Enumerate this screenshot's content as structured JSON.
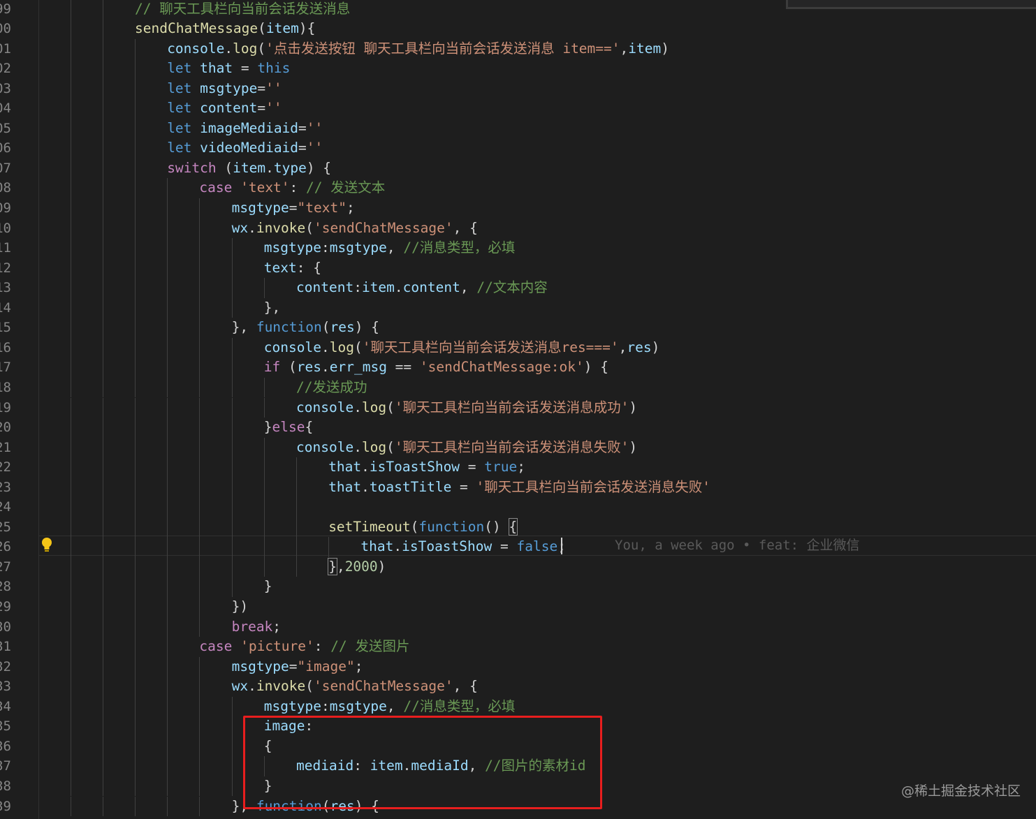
{
  "editor": {
    "lines": [
      {
        "ln": "99",
        "indent": 0,
        "tokens": [
          {
            "t": "com",
            "v": "// 聊天工具栏向当前会话发送消息"
          }
        ]
      },
      {
        "ln": "00",
        "indent": 0,
        "tokens": [
          {
            "t": "fn",
            "v": "sendChatMessage"
          },
          {
            "t": "pun",
            "v": "("
          },
          {
            "t": "var",
            "v": "item"
          },
          {
            "t": "pun",
            "v": "){"
          }
        ]
      },
      {
        "ln": "01",
        "indent": 1,
        "tokens": [
          {
            "t": "var",
            "v": "console"
          },
          {
            "t": "pun",
            "v": "."
          },
          {
            "t": "fn",
            "v": "log"
          },
          {
            "t": "pun",
            "v": "("
          },
          {
            "t": "str",
            "v": "'点击发送按钮 聊天工具栏向当前会话发送消息 item=='"
          },
          {
            "t": "pun",
            "v": ","
          },
          {
            "t": "var",
            "v": "item"
          },
          {
            "t": "pun",
            "v": ")"
          }
        ]
      },
      {
        "ln": "02",
        "indent": 1,
        "tokens": [
          {
            "t": "kw",
            "v": "let "
          },
          {
            "t": "var",
            "v": "that"
          },
          {
            "t": "pun",
            "v": " = "
          },
          {
            "t": "kw",
            "v": "this"
          }
        ]
      },
      {
        "ln": "03",
        "indent": 1,
        "tokens": [
          {
            "t": "kw",
            "v": "let "
          },
          {
            "t": "var",
            "v": "msgtype"
          },
          {
            "t": "pun",
            "v": "="
          },
          {
            "t": "str",
            "v": "''"
          }
        ]
      },
      {
        "ln": "04",
        "indent": 1,
        "tokens": [
          {
            "t": "kw",
            "v": "let "
          },
          {
            "t": "var",
            "v": "content"
          },
          {
            "t": "pun",
            "v": "="
          },
          {
            "t": "str",
            "v": "''"
          }
        ]
      },
      {
        "ln": "05",
        "indent": 1,
        "tokens": [
          {
            "t": "kw",
            "v": "let "
          },
          {
            "t": "var",
            "v": "imageMediaid"
          },
          {
            "t": "pun",
            "v": "="
          },
          {
            "t": "str",
            "v": "''"
          }
        ]
      },
      {
        "ln": "06",
        "indent": 1,
        "tokens": [
          {
            "t": "kw",
            "v": "let "
          },
          {
            "t": "var",
            "v": "videoMediaid"
          },
          {
            "t": "pun",
            "v": "="
          },
          {
            "t": "str",
            "v": "''"
          }
        ]
      },
      {
        "ln": "07",
        "indent": 1,
        "tokens": [
          {
            "t": "ctl",
            "v": "switch"
          },
          {
            "t": "pun",
            "v": " ("
          },
          {
            "t": "var",
            "v": "item"
          },
          {
            "t": "pun",
            "v": "."
          },
          {
            "t": "var",
            "v": "type"
          },
          {
            "t": "pun",
            "v": ") {"
          }
        ]
      },
      {
        "ln": "08",
        "indent": 2,
        "tokens": [
          {
            "t": "ctl",
            "v": "case "
          },
          {
            "t": "str",
            "v": "'text'"
          },
          {
            "t": "pun",
            "v": ": "
          },
          {
            "t": "com",
            "v": "// 发送文本"
          }
        ]
      },
      {
        "ln": "09",
        "indent": 3,
        "tokens": [
          {
            "t": "var",
            "v": "msgtype"
          },
          {
            "t": "pun",
            "v": "="
          },
          {
            "t": "str",
            "v": "\"text\""
          },
          {
            "t": "pun",
            "v": ";"
          }
        ]
      },
      {
        "ln": "10",
        "indent": 3,
        "tokens": [
          {
            "t": "var",
            "v": "wx"
          },
          {
            "t": "pun",
            "v": "."
          },
          {
            "t": "fn",
            "v": "invoke"
          },
          {
            "t": "pun",
            "v": "("
          },
          {
            "t": "str",
            "v": "'sendChatMessage'"
          },
          {
            "t": "pun",
            "v": ", {"
          }
        ]
      },
      {
        "ln": "11",
        "indent": 4,
        "tokens": [
          {
            "t": "var",
            "v": "msgtype"
          },
          {
            "t": "pun",
            "v": ":"
          },
          {
            "t": "var",
            "v": "msgtype"
          },
          {
            "t": "pun",
            "v": ", "
          },
          {
            "t": "com",
            "v": "//消息类型，必填"
          }
        ]
      },
      {
        "ln": "12",
        "indent": 4,
        "tokens": [
          {
            "t": "var",
            "v": "text"
          },
          {
            "t": "pun",
            "v": ": {"
          }
        ]
      },
      {
        "ln": "13",
        "indent": 5,
        "tokens": [
          {
            "t": "var",
            "v": "content"
          },
          {
            "t": "pun",
            "v": ":"
          },
          {
            "t": "var",
            "v": "item"
          },
          {
            "t": "pun",
            "v": "."
          },
          {
            "t": "var",
            "v": "content"
          },
          {
            "t": "pun",
            "v": ", "
          },
          {
            "t": "com",
            "v": "//文本内容"
          }
        ]
      },
      {
        "ln": "14",
        "indent": 4,
        "tokens": [
          {
            "t": "pun",
            "v": "},"
          }
        ]
      },
      {
        "ln": "15",
        "indent": 3,
        "tokens": [
          {
            "t": "pun",
            "v": "}, "
          },
          {
            "t": "kw",
            "v": "function"
          },
          {
            "t": "pun",
            "v": "("
          },
          {
            "t": "var",
            "v": "res"
          },
          {
            "t": "pun",
            "v": ") {"
          }
        ]
      },
      {
        "ln": "16",
        "indent": 4,
        "tokens": [
          {
            "t": "var",
            "v": "console"
          },
          {
            "t": "pun",
            "v": "."
          },
          {
            "t": "fn",
            "v": "log"
          },
          {
            "t": "pun",
            "v": "("
          },
          {
            "t": "str",
            "v": "'聊天工具栏向当前会话发送消息res==='"
          },
          {
            "t": "pun",
            "v": ","
          },
          {
            "t": "var",
            "v": "res"
          },
          {
            "t": "pun",
            "v": ")"
          }
        ]
      },
      {
        "ln": "17",
        "indent": 4,
        "tokens": [
          {
            "t": "ctl",
            "v": "if"
          },
          {
            "t": "pun",
            "v": " ("
          },
          {
            "t": "var",
            "v": "res"
          },
          {
            "t": "pun",
            "v": "."
          },
          {
            "t": "var",
            "v": "err_msg"
          },
          {
            "t": "pun",
            "v": " == "
          },
          {
            "t": "str",
            "v": "'sendChatMessage:ok'"
          },
          {
            "t": "pun",
            "v": ") {"
          }
        ]
      },
      {
        "ln": "18",
        "indent": 5,
        "tokens": [
          {
            "t": "com",
            "v": "//发送成功"
          }
        ]
      },
      {
        "ln": "19",
        "indent": 5,
        "tokens": [
          {
            "t": "var",
            "v": "console"
          },
          {
            "t": "pun",
            "v": "."
          },
          {
            "t": "fn",
            "v": "log"
          },
          {
            "t": "pun",
            "v": "("
          },
          {
            "t": "str",
            "v": "'聊天工具栏向当前会话发送消息成功'"
          },
          {
            "t": "pun",
            "v": ")"
          }
        ]
      },
      {
        "ln": "20",
        "indent": 4,
        "tokens": [
          {
            "t": "pun",
            "v": "}"
          },
          {
            "t": "ctl",
            "v": "else"
          },
          {
            "t": "pun",
            "v": "{"
          }
        ]
      },
      {
        "ln": "21",
        "indent": 5,
        "tokens": [
          {
            "t": "var",
            "v": "console"
          },
          {
            "t": "pun",
            "v": "."
          },
          {
            "t": "fn",
            "v": "log"
          },
          {
            "t": "pun",
            "v": "("
          },
          {
            "t": "str",
            "v": "'聊天工具栏向当前会话发送消息失败'"
          },
          {
            "t": "pun",
            "v": ")"
          }
        ]
      },
      {
        "ln": "22",
        "indent": 6,
        "tokens": [
          {
            "t": "var",
            "v": "that"
          },
          {
            "t": "pun",
            "v": "."
          },
          {
            "t": "var",
            "v": "isToastShow"
          },
          {
            "t": "pun",
            "v": " = "
          },
          {
            "t": "bool",
            "v": "true"
          },
          {
            "t": "pun",
            "v": ";"
          }
        ]
      },
      {
        "ln": "23",
        "indent": 6,
        "tokens": [
          {
            "t": "var",
            "v": "that"
          },
          {
            "t": "pun",
            "v": "."
          },
          {
            "t": "var",
            "v": "toastTitle"
          },
          {
            "t": "pun",
            "v": " = "
          },
          {
            "t": "str",
            "v": "'聊天工具栏向当前会话发送消息失败'"
          }
        ]
      },
      {
        "ln": "24",
        "indent": 6,
        "tokens": []
      },
      {
        "ln": "25",
        "indent": 6,
        "tokens": [
          {
            "t": "fn",
            "v": "setTimeout"
          },
          {
            "t": "pun",
            "v": "("
          },
          {
            "t": "kw",
            "v": "function"
          },
          {
            "t": "pun",
            "v": "() "
          },
          {
            "t": "pun",
            "v": "{",
            "match": true
          }
        ]
      },
      {
        "ln": "26",
        "indent": 7,
        "tokens": [
          {
            "t": "var",
            "v": "that"
          },
          {
            "t": "pun",
            "v": "."
          },
          {
            "t": "var",
            "v": "isToastShow"
          },
          {
            "t": "pun",
            "v": " = "
          },
          {
            "t": "bool",
            "v": "false"
          },
          {
            "t": "pun",
            "v": ";"
          }
        ]
      },
      {
        "ln": "27",
        "indent": 6,
        "tokens": [
          {
            "t": "pun",
            "v": "}",
            "match": true
          },
          {
            "t": "pun",
            "v": ","
          },
          {
            "t": "num",
            "v": "2000"
          },
          {
            "t": "pun",
            "v": ")"
          }
        ]
      },
      {
        "ln": "28",
        "indent": 4,
        "tokens": [
          {
            "t": "pun",
            "v": "}"
          }
        ]
      },
      {
        "ln": "29",
        "indent": 3,
        "tokens": [
          {
            "t": "pun",
            "v": "})"
          }
        ]
      },
      {
        "ln": "30",
        "indent": 3,
        "tokens": [
          {
            "t": "ctl",
            "v": "break"
          },
          {
            "t": "pun",
            "v": ";"
          }
        ]
      },
      {
        "ln": "31",
        "indent": 2,
        "tokens": [
          {
            "t": "ctl",
            "v": "case "
          },
          {
            "t": "str",
            "v": "'picture'"
          },
          {
            "t": "pun",
            "v": ": "
          },
          {
            "t": "com",
            "v": "// 发送图片"
          }
        ]
      },
      {
        "ln": "32",
        "indent": 3,
        "tokens": [
          {
            "t": "var",
            "v": "msgtype"
          },
          {
            "t": "pun",
            "v": "="
          },
          {
            "t": "str",
            "v": "\"image\""
          },
          {
            "t": "pun",
            "v": ";"
          }
        ]
      },
      {
        "ln": "33",
        "indent": 3,
        "tokens": [
          {
            "t": "var",
            "v": "wx"
          },
          {
            "t": "pun",
            "v": "."
          },
          {
            "t": "fn",
            "v": "invoke"
          },
          {
            "t": "pun",
            "v": "("
          },
          {
            "t": "str",
            "v": "'sendChatMessage'"
          },
          {
            "t": "pun",
            "v": ", {"
          }
        ]
      },
      {
        "ln": "34",
        "indent": 4,
        "tokens": [
          {
            "t": "var",
            "v": "msgtype"
          },
          {
            "t": "pun",
            "v": ":"
          },
          {
            "t": "var",
            "v": "msgtype"
          },
          {
            "t": "pun",
            "v": ", "
          },
          {
            "t": "com",
            "v": "//消息类型，必填"
          }
        ]
      },
      {
        "ln": "35",
        "indent": 4,
        "tokens": [
          {
            "t": "var",
            "v": "image"
          },
          {
            "t": "pun",
            "v": ":"
          }
        ]
      },
      {
        "ln": "36",
        "indent": 4,
        "tokens": [
          {
            "t": "pun",
            "v": "{"
          }
        ]
      },
      {
        "ln": "37",
        "indent": 5,
        "tokens": [
          {
            "t": "var",
            "v": "mediaid"
          },
          {
            "t": "pun",
            "v": ": "
          },
          {
            "t": "var",
            "v": "item"
          },
          {
            "t": "pun",
            "v": "."
          },
          {
            "t": "var",
            "v": "mediaId"
          },
          {
            "t": "pun",
            "v": ", "
          },
          {
            "t": "com",
            "v": "//图片的素材id"
          }
        ]
      },
      {
        "ln": "38",
        "indent": 4,
        "tokens": [
          {
            "t": "pun",
            "v": "}"
          }
        ]
      },
      {
        "ln": "39",
        "indent": 3,
        "tokens": [
          {
            "t": "pun",
            "v": "}, "
          },
          {
            "t": "kw",
            "v": "function"
          },
          {
            "t": "pun",
            "v": "("
          },
          {
            "t": "var",
            "v": "res"
          },
          {
            "t": "pun",
            "v": ") {"
          }
        ]
      }
    ],
    "current_line_ln": "26",
    "blame_annotation": "You, a week ago • feat: 企业微信",
    "lightbulb_icon": "lightbulb-icon"
  },
  "watermark": "@稀土掘金技术社区",
  "colors": {
    "background": "#1e1e1e",
    "keyword": "#569cd6",
    "control": "#c586c0",
    "function": "#dcdcaa",
    "variable": "#9cdcfe",
    "string": "#ce9178",
    "comment": "#6a9955",
    "number": "#b5cea8",
    "highlight_box": "#e81e1e"
  }
}
